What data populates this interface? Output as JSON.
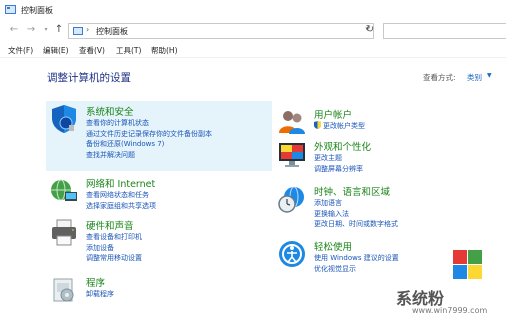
{
  "window": {
    "title": "控制面板"
  },
  "nav": {
    "back_icon": "arrow-left",
    "forward_icon": "arrow-right",
    "recent_icon": "chevron-down",
    "up_icon": "arrow-up",
    "address_separator": "›",
    "breadcrumb": "控制面板",
    "refresh_icon": "refresh"
  },
  "menu": [
    "文件(F)",
    "编辑(E)",
    "查看(V)",
    "工具(T)",
    "帮助(H)"
  ],
  "main": {
    "heading": "调整计算机的设置",
    "view_by_label": "查看方式:",
    "view_by_value": "类别"
  },
  "categories": [
    {
      "title": "系统和安全",
      "icon": "shield-icon",
      "links": [
        "查看你的计算机状态",
        "通过文件历史记录保存你的文件备份副本",
        "备份和还原(Windows 7)",
        "查找并解决问题"
      ]
    },
    {
      "title": "网络和 Internet",
      "icon": "network-globe-icon",
      "links": [
        "查看网络状态和任务",
        "选择家庭组和共享选项"
      ]
    },
    {
      "title": "硬件和声音",
      "icon": "printer-icon",
      "links": [
        "查看设备和打印机",
        "添加设备",
        "调整常用移动设置"
      ]
    },
    {
      "title": "程序",
      "icon": "programs-icon",
      "links": [
        "卸载程序"
      ]
    },
    {
      "title": "用户帐户",
      "icon": "users-icon",
      "links": [
        "更改帐户类型"
      ]
    },
    {
      "title": "外观和个性化",
      "icon": "monitor-icon",
      "links": [
        "更改主题",
        "调整屏幕分辨率"
      ]
    },
    {
      "title": "时钟、语言和区域",
      "icon": "clock-globe-icon",
      "links": [
        "添加语言",
        "更换输入法",
        "更改日期、时间或数字格式"
      ]
    },
    {
      "title": "轻松使用",
      "icon": "ease-of-access-icon",
      "links": [
        "使用 Windows 建议的设置",
        "优化视觉显示"
      ]
    }
  ],
  "watermark": {
    "text": "系统粉",
    "url": "www.win7999.com"
  },
  "colors": {
    "category_title": "#1a8418",
    "link": "#1a55b8",
    "heading": "#1e3287",
    "hover_bg": "#e5f3fb"
  }
}
